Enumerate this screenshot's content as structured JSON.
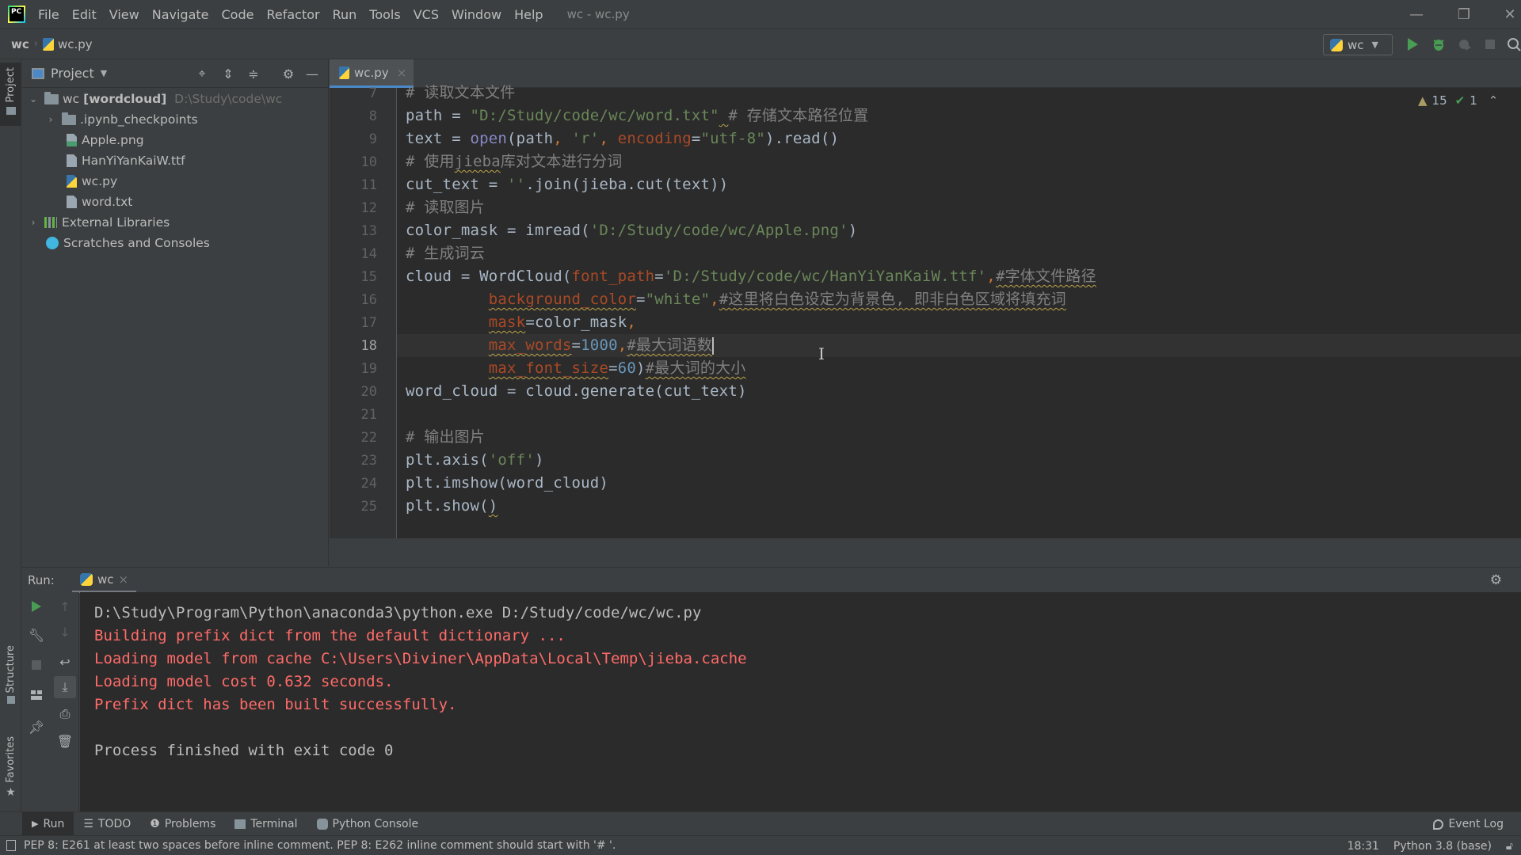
{
  "app": {
    "logo_text": "PC",
    "window_title": "wc - wc.py",
    "menu": [
      "File",
      "Edit",
      "View",
      "Navigate",
      "Code",
      "Refactor",
      "Run",
      "Tools",
      "VCS",
      "Window",
      "Help"
    ]
  },
  "window_controls": {
    "minimize": "—",
    "restore": "❐",
    "close": "✕"
  },
  "navbar": {
    "breadcrumbs": [
      "wc",
      "wc.py"
    ],
    "run_config": "wc",
    "icons": [
      "python-icon",
      "run-icon",
      "debug-icon",
      "coverage-icon",
      "stop-icon",
      "search-icon"
    ]
  },
  "left_stripe": {
    "project_label": "Project",
    "structure_label": "Structure",
    "favorites_label": "Favorites"
  },
  "project_panel": {
    "title": "Project",
    "root": {
      "name": "wc",
      "module": "[wordcloud]",
      "path": "D:\\Study\\code\\wc"
    },
    "items": [
      {
        "name": ".ipynb_checkpoints",
        "type": "folder",
        "expandable": true
      },
      {
        "name": "Apple.png",
        "type": "image"
      },
      {
        "name": "HanYiYanKaiW.ttf",
        "type": "font"
      },
      {
        "name": "wc.py",
        "type": "python"
      },
      {
        "name": "word.txt",
        "type": "text"
      }
    ],
    "external_libraries": "External Libraries",
    "scratches": "Scratches and Consoles"
  },
  "editor": {
    "tab": {
      "label": "wc.py",
      "close": "×"
    },
    "inspection": {
      "warnings": "15",
      "ok": "1"
    },
    "current_line": 18,
    "lines": [
      {
        "n": "7",
        "parts": [
          [
            "c-comment",
            "# 读取文本文件"
          ]
        ]
      },
      {
        "n": "8",
        "parts": [
          [
            "",
            "path = "
          ],
          [
            "c-string",
            "\"D:/Study/code/wc/word.txt\""
          ],
          [
            "squig",
            " "
          ],
          [
            "c-comment",
            "# 存储文本路径位置"
          ]
        ]
      },
      {
        "n": "9",
        "parts": [
          [
            "",
            "text = "
          ],
          [
            "c-builtin",
            "open"
          ],
          [
            "",
            "(path"
          ],
          [
            "c-kw",
            ", "
          ],
          [
            "c-string",
            "'r'"
          ],
          [
            "c-kw",
            ", "
          ],
          [
            "c-param",
            "encoding"
          ],
          [
            "",
            "="
          ],
          [
            "c-string",
            "\"utf-8\""
          ],
          [
            "",
            ").read()"
          ]
        ]
      },
      {
        "n": "10",
        "parts": [
          [
            "c-comment",
            "# 使用"
          ],
          [
            "c-comment squig",
            "jieba"
          ],
          [
            "c-comment",
            "库对文本进行分词"
          ]
        ]
      },
      {
        "n": "11",
        "parts": [
          [
            "",
            "cut_text = "
          ],
          [
            "c-string",
            "''"
          ],
          [
            "",
            ".join(jieba.cut(text))"
          ]
        ]
      },
      {
        "n": "12",
        "parts": [
          [
            "c-comment",
            "# 读取图片"
          ]
        ]
      },
      {
        "n": "13",
        "parts": [
          [
            "",
            "color_mask = imread("
          ],
          [
            "c-string",
            "'D:/Study/code/wc/Apple.png'"
          ],
          [
            "",
            ")"
          ]
        ]
      },
      {
        "n": "14",
        "parts": [
          [
            "c-comment",
            "# 生成词云"
          ]
        ]
      },
      {
        "n": "15",
        "parts": [
          [
            "",
            "cloud = WordCloud("
          ],
          [
            "c-param",
            "font_path"
          ],
          [
            "",
            "="
          ],
          [
            "c-string",
            "'D:/Study/code/wc/HanYiYanKaiW.ttf'"
          ],
          [
            "c-kw",
            ","
          ],
          [
            "c-comment squig",
            "#字体文件路径"
          ]
        ]
      },
      {
        "n": "16",
        "parts": [
          [
            "",
            "         "
          ],
          [
            "c-param squig",
            "background_color"
          ],
          [
            "",
            "="
          ],
          [
            "c-string",
            "\"white\""
          ],
          [
            "c-kw",
            ","
          ],
          [
            "c-comment squig",
            "#这里将白色设定为背景色, 即非白色区域将填充词"
          ]
        ]
      },
      {
        "n": "17",
        "parts": [
          [
            "",
            "         "
          ],
          [
            "c-param squig",
            "mask"
          ],
          [
            "",
            "=color_mask"
          ],
          [
            "c-kw",
            ","
          ]
        ]
      },
      {
        "n": "18",
        "parts": [
          [
            "",
            "         "
          ],
          [
            "c-param squig",
            "max_words"
          ],
          [
            "",
            "="
          ],
          [
            "c-num",
            "1000"
          ],
          [
            "c-kw",
            ","
          ],
          [
            "c-comment squig",
            "#最大词语数"
          ],
          [
            "caret",
            ""
          ]
        ]
      },
      {
        "n": "19",
        "parts": [
          [
            "",
            "         "
          ],
          [
            "c-param squig",
            "max_font_size"
          ],
          [
            "",
            "="
          ],
          [
            "c-num",
            "60"
          ],
          [
            "",
            ")"
          ],
          [
            "c-comment squig",
            "#最大词的大小"
          ]
        ]
      },
      {
        "n": "20",
        "parts": [
          [
            "",
            "word_cloud = cloud.generate(cut_text)"
          ]
        ]
      },
      {
        "n": "21",
        "parts": []
      },
      {
        "n": "22",
        "parts": [
          [
            "c-comment",
            "# 输出图片"
          ]
        ]
      },
      {
        "n": "23",
        "parts": [
          [
            "",
            "plt.axis("
          ],
          [
            "c-string",
            "'off'"
          ],
          [
            "",
            ")"
          ]
        ]
      },
      {
        "n": "24",
        "parts": [
          [
            "",
            "plt.imshow(word_cloud)"
          ]
        ]
      },
      {
        "n": "25",
        "parts": [
          [
            "",
            "plt.show("
          ],
          [
            "squig",
            ")"
          ]
        ]
      }
    ]
  },
  "run_panel": {
    "label": "Run:",
    "tab": "wc",
    "tab_close": "×",
    "output": [
      {
        "kind": "out-normal",
        "text": "D:\\Study\\Program\\Python\\anaconda3\\python.exe D:/Study/code/wc/wc.py"
      },
      {
        "kind": "out-err",
        "text": "Building prefix dict from the default dictionary ..."
      },
      {
        "kind": "out-err",
        "text": "Loading model from cache C:\\Users\\Diviner\\AppData\\Local\\Temp\\jieba.cache"
      },
      {
        "kind": "out-err",
        "text": "Loading model cost 0.632 seconds."
      },
      {
        "kind": "out-err",
        "text": "Prefix dict has been built successfully."
      },
      {
        "kind": "out-normal",
        "text": ""
      },
      {
        "kind": "out-normal",
        "text": "Process finished with exit code 0"
      }
    ]
  },
  "tool_windows": {
    "run": "Run",
    "todo": "TODO",
    "problems": "Problems",
    "terminal": "Terminal",
    "python_console": "Python Console",
    "event_log": "Event Log"
  },
  "status_bar": {
    "message": "PEP 8: E261 at least two spaces before inline comment. PEP 8: E262 inline comment should start with '# '.",
    "position": "18:31",
    "interpreter": "Python 3.8 (base)"
  },
  "colors": {
    "background": "#2b2b2b",
    "panel": "#3c3f41",
    "accent": "#4a88c7",
    "run_green": "#499c54",
    "error_red": "#ff6b68",
    "string": "#6a8759",
    "keyword": "#cc7832",
    "comment": "#808080",
    "number": "#6897bb"
  }
}
